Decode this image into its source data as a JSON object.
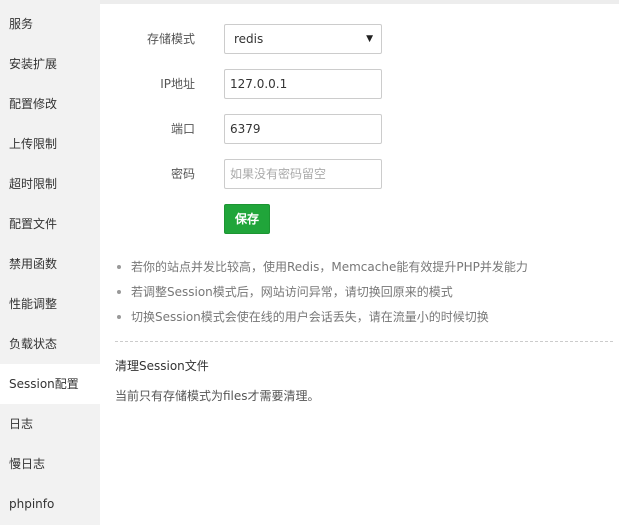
{
  "sidebar": {
    "items": [
      {
        "label": "服务"
      },
      {
        "label": "安装扩展"
      },
      {
        "label": "配置修改"
      },
      {
        "label": "上传限制"
      },
      {
        "label": "超时限制"
      },
      {
        "label": "配置文件"
      },
      {
        "label": "禁用函数"
      },
      {
        "label": "性能调整"
      },
      {
        "label": "负载状态"
      },
      {
        "label": "Session配置",
        "active": true
      },
      {
        "label": "日志"
      },
      {
        "label": "慢日志"
      },
      {
        "label": "phpinfo"
      }
    ]
  },
  "form": {
    "storage_mode": {
      "label": "存储模式",
      "value": "redis"
    },
    "ip": {
      "label": "IP地址",
      "value": "127.0.0.1"
    },
    "port": {
      "label": "端口",
      "value": "6379"
    },
    "password": {
      "label": "密码",
      "value": "",
      "placeholder": "如果没有密码留空"
    },
    "save_label": "保存"
  },
  "tips": [
    "若你的站点并发比较高，使用Redis，Memcache能有效提升PHP并发能力",
    "若调整Session模式后，网站访问异常，请切换回原来的模式",
    "切换Session模式会使在线的用户会话丢失，请在流量小的时候切换"
  ],
  "clear_section": {
    "title": "清理Session文件",
    "description": "当前只有存储模式为files才需要清理。"
  },
  "colors": {
    "accent": "#20a53a",
    "sidebar_bg": "#f2f2f2"
  },
  "icons": {
    "select_caret": "caret-down-icon"
  }
}
